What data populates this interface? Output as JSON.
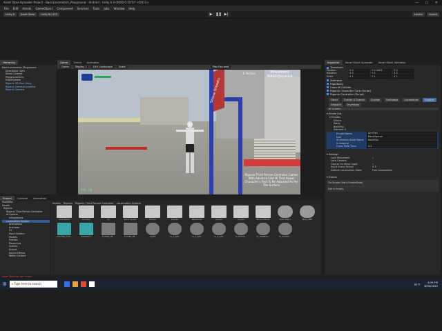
{
  "window": {
    "title": "Asset Store Uploader Project - BasicLocomotion_Playground - Android - Unity 6.0 (6000.0.31f1)* <DX11>"
  },
  "menu": [
    "File",
    "Edit",
    "Assets",
    "GameObject",
    "Component",
    "Services",
    "Tools",
    "Jobs",
    "Window",
    "Help"
  ],
  "toolbar": {
    "unity_label": "Unity 6",
    "asset_store": "Asset Store",
    "unity_version": "Unity 6.0 LTS",
    "layers": "Layers",
    "layout": "Layout"
  },
  "hierarchy": {
    "tab": "Hierarchy",
    "items": [
      {
        "label": "BasicLocomotion_Playground",
        "blue": false
      },
      {
        "label": "Directional Light",
        "blue": false
      },
      {
        "label": "Demo Camera",
        "blue": false
      },
      {
        "label": "Playground Env",
        "blue": false
      },
      {
        "label": "EventSystem",
        "blue": false
      },
      {
        "label": "Rigonix 3D Main Unity",
        "blue": true
      },
      {
        "label": "Rigonix CameraController",
        "blue": true
      },
      {
        "label": "Rigonix Camera",
        "blue": true
      }
    ]
  },
  "center_tabs": [
    {
      "label": "Game"
    },
    {
      "label": "Scene"
    },
    {
      "label": "Animator"
    }
  ],
  "game_bar": {
    "display": "Game",
    "display_num": "Display 1",
    "aspect": "16:9 Landscape",
    "scale": "Scale",
    "play_focused": "Play Focused"
  },
  "viewport": {
    "movement_line1": "Movement",
    "movement_line2": "WASD/Joystick",
    "action": "E Action",
    "sign_text": "Stone Streets",
    "fps": "FPS : 56",
    "info_text": "Rigonix Third Person Controller Comes With Advance Foot IK That Allows Character's Feet To Be Adjusted As Per The Surface"
  },
  "bottom_tabs": [
    {
      "label": "Project"
    },
    {
      "label": "Console"
    },
    {
      "label": "Animation"
    }
  ],
  "project": {
    "favorites": "Favorites",
    "tree": [
      "Assets",
      "Rigonix",
      "Rigonix Third Person Controller",
      "AI System",
      "Integrations",
      "Locomotion System",
      "Animations",
      "Animator",
      "FX",
      "Input System",
      "Models",
      "Prefabs",
      "Resources",
      "Scenes",
      "Scripts",
      "Sound Effects",
      "Water Contact"
    ],
    "breadcrumb": [
      "Assets",
      "Rigonix",
      "Rigonix Third Person Controller",
      "Locomotion System"
    ],
    "folders": [
      "Animations",
      "Animator",
      "FX",
      "Input System",
      "Models",
      "Prefabs",
      "Resources",
      "Scenes",
      "Scripts",
      "Sound Effects"
    ],
    "row2": [
      "AnimPlay_Idle...",
      "animPlay 1",
      "FL2020_SB...",
      "FL2019_SB...",
      "Lights",
      "m_1_spec",
      "m_3_spec",
      "m_4_spec",
      "m_ErrChk...",
      "m_FeetBlue...",
      "m_FeetGrn..."
    ],
    "extra": [
      "Anim Play 1",
      "Body_SMR"
    ]
  },
  "inspector": {
    "tabs": [
      {
        "label": "Inspector"
      },
      {
        "label": "Asset Store Uploader"
      },
      {
        "label": "Asset Store Validator"
      }
    ],
    "transform": {
      "label": "Transform",
      "position": [
        "Position",
        "X 0",
        "Y 0.0005",
        "Z 0"
      ],
      "rotation": [
        "Rotation",
        "X 0",
        "Y 0",
        "Z 0"
      ],
      "scale": [
        "Scale",
        "X 1",
        "Y 1",
        "Z 1"
      ]
    },
    "components": [
      "Animator",
      "Rigidbody",
      "Capsule Collider",
      "Rigonix Character Core (Script)",
      "Rigonix Controller (Script)"
    ],
    "sub_tabs": [
      "Other",
      "Events & Events",
      "Grudge",
      "Footsteps",
      "Locomotion",
      "Emotes",
      "Setpoint",
      "Inventory"
    ],
    "sub_tab_active": "Emotes",
    "system": "AI System",
    "emote_list": "Emote List",
    "emotes": "Emotes",
    "emote_items": [
      "Dance",
      "Wave",
      "BackFlip",
      "Element 3"
    ],
    "element_fields": [
      {
        "label": "Emote Name",
        "value": "AimFlex"
      },
      {
        "label": "Icon",
        "value": "BackflipIcon"
      },
      {
        "label": "Animation State Name",
        "value": "BackFlip"
      },
      {
        "label": "Is Looping",
        "value": ""
      },
      {
        "label": "Cross Fade Time",
        "value": "0.2"
      }
    ],
    "settings": "Settings",
    "settings_rows": [
      {
        "label": "Lock Movement",
        "value": "✓"
      },
      {
        "label": "Lock Camera",
        "value": ""
      },
      {
        "label": "Cancel On Move Input",
        "value": "✓"
      },
      {
        "label": "Input Grace Period",
        "value": "0.3"
      },
      {
        "label": "Default Locomotion State",
        "value": "Free Locomotion"
      }
    ],
    "events": "Events",
    "event_name": "On Emote Start (EmoteData)",
    "list_empty": "List is Empty"
  },
  "status": {
    "text": "Asset Pipeline: dev mode..."
  },
  "taskbar": {
    "search": "Type here to search",
    "time": "4:09 PM",
    "date": "8/30/2025",
    "weather": "85°F"
  },
  "colors": {
    "accent": "#4a8dff",
    "taskbar": "#1b2330",
    "panel": "#282828"
  }
}
